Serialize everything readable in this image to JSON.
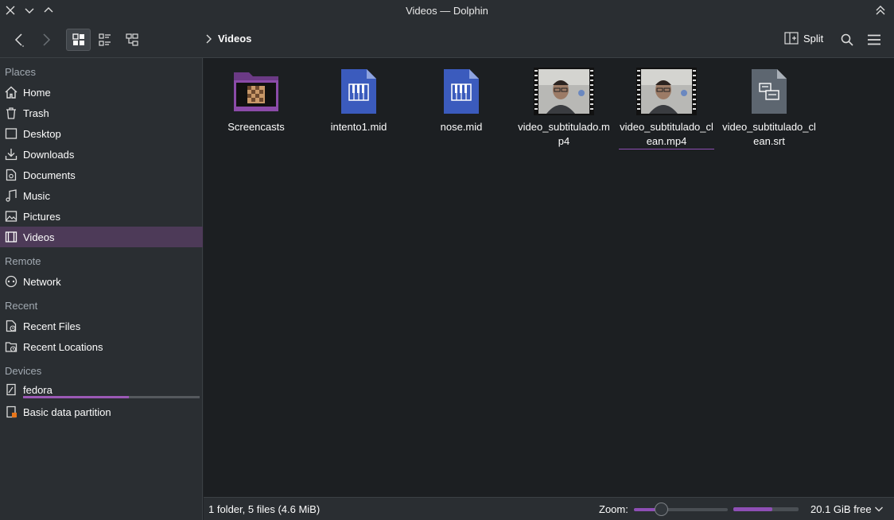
{
  "window": {
    "title": "Videos — Dolphin"
  },
  "toolbar": {
    "breadcrumb": "Videos",
    "split_label": "Split"
  },
  "sidebar": {
    "sections": {
      "places": "Places",
      "remote": "Remote",
      "recent": "Recent",
      "devices": "Devices"
    },
    "places": [
      {
        "label": "Home",
        "icon": "home-icon"
      },
      {
        "label": "Trash",
        "icon": "trash-icon"
      },
      {
        "label": "Desktop",
        "icon": "desktop-icon"
      },
      {
        "label": "Downloads",
        "icon": "download-icon"
      },
      {
        "label": "Documents",
        "icon": "document-icon"
      },
      {
        "label": "Music",
        "icon": "music-icon"
      },
      {
        "label": "Pictures",
        "icon": "picture-icon"
      },
      {
        "label": "Videos",
        "icon": "video-icon",
        "selected": true
      }
    ],
    "remote": [
      {
        "label": "Network",
        "icon": "network-icon"
      }
    ],
    "recent": [
      {
        "label": "Recent Files",
        "icon": "recent-files-icon"
      },
      {
        "label": "Recent Locations",
        "icon": "recent-locations-icon"
      }
    ],
    "devices": [
      {
        "label": "fedora",
        "icon": "drive-icon",
        "capacity_used": 0.6
      },
      {
        "label": "Basic data partition",
        "icon": "partition-icon"
      }
    ]
  },
  "files": [
    {
      "name": "Screencasts",
      "type": "folder"
    },
    {
      "name": "intento1.mid",
      "type": "midi"
    },
    {
      "name": "nose.mid",
      "type": "midi"
    },
    {
      "name": "video_subtitulado.mp4",
      "type": "video"
    },
    {
      "name": "video_subtitulado_clean.mp4",
      "type": "video"
    },
    {
      "name": "video_subtitulado_clean.srt",
      "type": "subtitle"
    }
  ],
  "statusbar": {
    "summary": "1 folder, 5 files (4.6 MiB)",
    "zoom_label": "Zoom:",
    "zoom_level": 0.3,
    "free_space": "20.1 GiB free",
    "disk_used": 0.6
  },
  "colors": {
    "accent": "#8e4fb5",
    "selection": "#4d3a58",
    "midi_icon": "#3b5bbd",
    "folder": "#8b4ba8"
  }
}
